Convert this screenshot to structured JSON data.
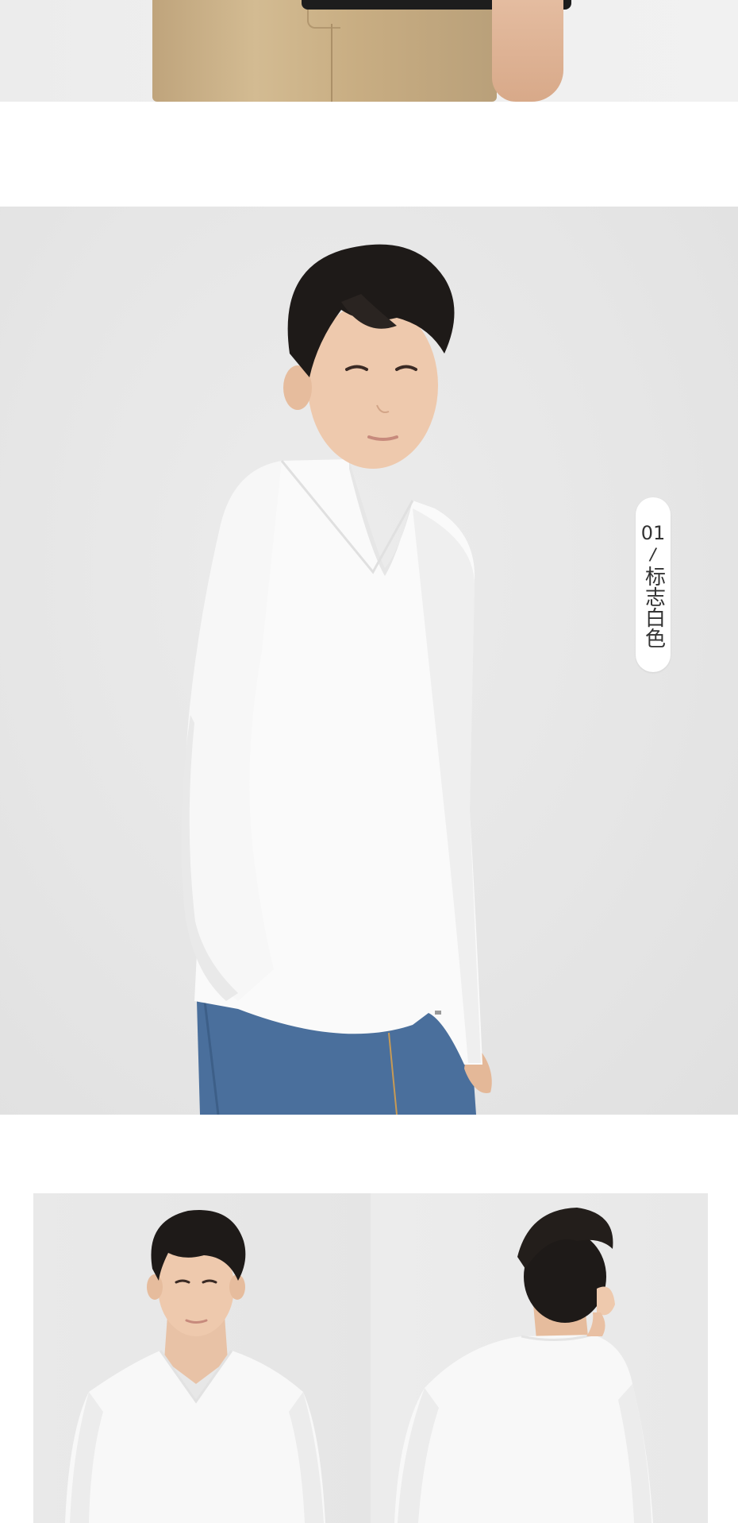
{
  "top_section": {
    "image_name": "model-khaki-trousers-photo"
  },
  "hero_section": {
    "image_name": "model-white-v-neck-longsleeve-photo",
    "color_tag": {
      "number": "01",
      "separator": "/",
      "color_name": "标志白色"
    }
  },
  "detail_section": {
    "front_image_name": "front-view-photo",
    "back_image_name": "back-view-photo"
  },
  "colors": {
    "background": "#ffffff",
    "photo_backdrop": "#e6e6e6",
    "shirt": "#fafafa",
    "jeans": "#4a6f9c",
    "trousers": "#c9af86",
    "hair": "#1e1a18",
    "tag_text": "#333333"
  }
}
